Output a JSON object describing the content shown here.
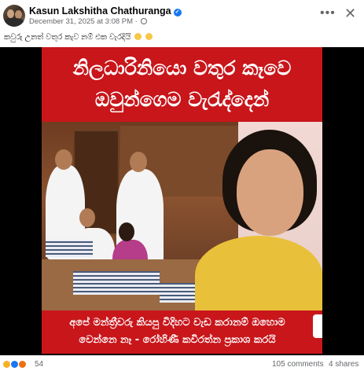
{
  "post": {
    "author": "Kasun Lakshitha Chathuranga",
    "date": "December 31, 2025 at 3:08 PM",
    "caption": "කවුරු උනත් වතුර කැව නම් එක වැරදියි",
    "menu_icon": "more-horizontal-icon",
    "close_icon": "close-icon"
  },
  "image_text": {
    "headline_line1": "නිලධාරිනියො වතුර කෑවෙ",
    "headline_line2": "ඔවුන්ගෙම වැරැද්දෙන්",
    "subtitle_line1": "අපේ මන්ත්‍රීවරු කියපු විදිහට වැඩ කරානම් ඔහොම",
    "subtitle_line2": "වෙන්නෙ නෑ - රෝහිණී කවිරත්න ප්‍රකාශ කරයි"
  },
  "stats": {
    "reaction_count": "54",
    "comments": "105 comments",
    "shares": "4 shares"
  },
  "colors": {
    "banner": "#c8161b",
    "meta_text": "#65676b",
    "verified": "#1877f2"
  }
}
